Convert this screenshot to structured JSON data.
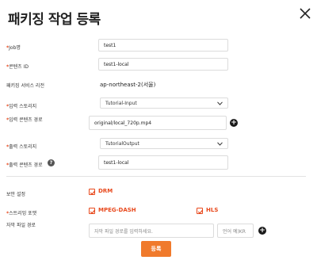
{
  "dialog": {
    "title": "패키징 작업 등록",
    "submit_label": "등록"
  },
  "form": {
    "job_name": {
      "label": "Job명",
      "value": "test1"
    },
    "content_id": {
      "label": "콘텐츠 ID",
      "value": "test1-local"
    },
    "region": {
      "label": "패키징 서비스 리전",
      "value": "ap-northeast-2(서울)"
    },
    "input_storage": {
      "label": "입력 스토리지",
      "value": "Tutorial-Input"
    },
    "input_path": {
      "label": "입력 콘텐츠 경로",
      "value": "original/local_720p.mp4"
    },
    "output_storage": {
      "label": "출력 스토리지",
      "value": "TutorialOutput"
    },
    "output_path": {
      "label": "출력 콘텐츠 경로",
      "value": "test1-local"
    },
    "security": {
      "label": "보안 설정",
      "options": [
        {
          "label": "DRM",
          "checked": true
        }
      ]
    },
    "streaming": {
      "label": "스트리밍 포맷",
      "options": [
        {
          "label": "MPEG-DASH",
          "checked": true
        },
        {
          "label": "HLS",
          "checked": true
        }
      ]
    },
    "subtitle": {
      "label": "자막 파일 경로",
      "placeholder": "자막 파일 경로를 입력하세요.",
      "lang_placeholder": "언어 예)KR"
    }
  },
  "required_marker": "*",
  "colors": {
    "accent": "#e8491d",
    "button": "#f07a2c"
  },
  "icons": {
    "close": "close-icon",
    "add": "plus-circle-icon",
    "help": "question-circle-icon",
    "dropdown": "chevron-down-icon",
    "check": "check-icon"
  }
}
